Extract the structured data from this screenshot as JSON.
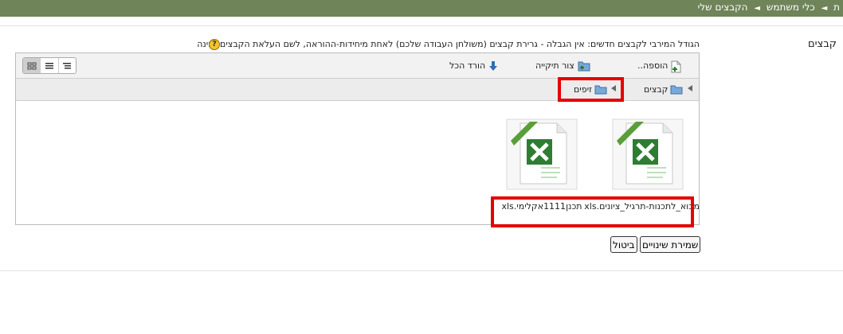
{
  "breadcrumb": {
    "items": [
      "ת",
      "כלי משתמש",
      "הקבצים שלי"
    ]
  },
  "field_label": "קבצים",
  "max_size_text": "הגודל המירבי לקבצים חדשים: אין הגבלה - גרירת קבצים (משולחן העבודה שלכם) לאחת מיחידות-ההוראה, לשם העלאת הקבצים זמינה",
  "toolbar": {
    "add_label": "הוספה..",
    "create_folder_label": "צור תיקייה",
    "download_all_label": "הורד הכל"
  },
  "path": {
    "root": "קבצים",
    "current": "זיפים"
  },
  "files": [
    {
      "name": "מבוא_לתכנות-תרגיל_ציונים.xls"
    },
    {
      "name": "תכנן1111אקלימי.xls"
    }
  ],
  "buttons": {
    "save": "שמירת שינויים",
    "cancel": "ביטול"
  },
  "colors": {
    "header": "#6f8458",
    "highlight": "#e60000",
    "excel_green": "#2e7d32"
  }
}
